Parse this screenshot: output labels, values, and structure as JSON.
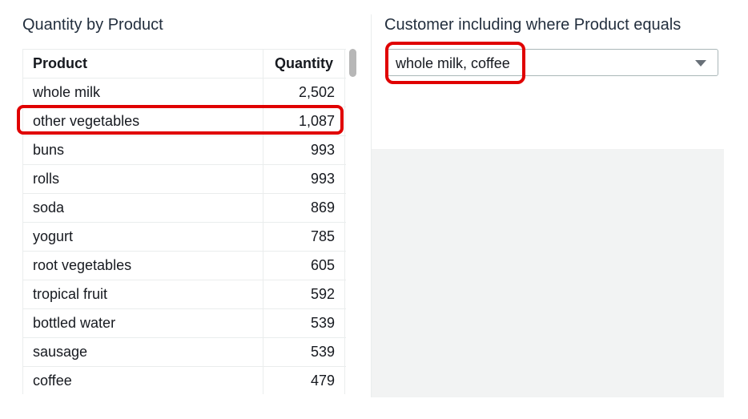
{
  "left_panel": {
    "title": "Quantity by Product",
    "columns": {
      "product": "Product",
      "quantity": "Quantity"
    },
    "rows": [
      {
        "product": "whole milk",
        "quantity": "2,502"
      },
      {
        "product": "other vegetables",
        "quantity": "1,087"
      },
      {
        "product": "buns",
        "quantity": "993"
      },
      {
        "product": "rolls",
        "quantity": "993"
      },
      {
        "product": "soda",
        "quantity": "869"
      },
      {
        "product": "yogurt",
        "quantity": "785"
      },
      {
        "product": "root vegetables",
        "quantity": "605"
      },
      {
        "product": "tropical fruit",
        "quantity": "592"
      },
      {
        "product": "bottled water",
        "quantity": "539"
      },
      {
        "product": "sausage",
        "quantity": "539"
      },
      {
        "product": "coffee",
        "quantity": "479"
      }
    ]
  },
  "right_panel": {
    "title": "Customer including where Product equals",
    "dropdown_value": "whole milk, coffee",
    "dropdown_icon": "caret-down-icon"
  },
  "colors": {
    "highlight": "#e00000",
    "border": "#eaeded",
    "empty_area": "#f2f3f3"
  }
}
